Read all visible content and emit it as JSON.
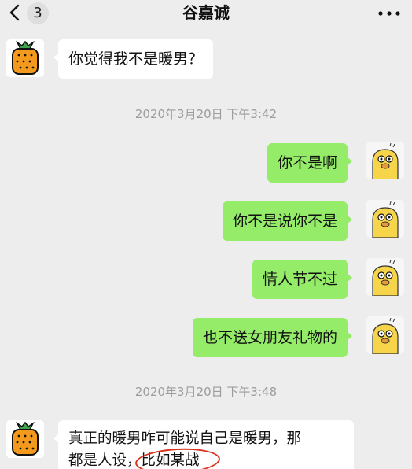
{
  "header": {
    "unread_count": "3",
    "title": "谷嘉诚"
  },
  "timestamps": {
    "t1": "2020年3月20日 下午3:42",
    "t2": "2020年3月20日 下午3:48"
  },
  "messages": {
    "m1": "你觉得我不是暖男？",
    "m2": "你不是啊",
    "m3": "你不是说你不是",
    "m4": "情人节不过",
    "m5": "也不送女朋友礼物的",
    "m6_line1": "真正的暖男咋可能说自己是暖男，那",
    "m6_line2_a": "都是人设，",
    "m6_line2_b": "比如某战"
  },
  "colors": {
    "outgoing_bubble": "#95ec69",
    "incoming_bubble": "#ffffff",
    "background": "#ededed",
    "annotation": "#d9321f"
  },
  "icons": {
    "back": "chevron-left-icon",
    "more": "more-dots-icon",
    "contact_avatar": "orange-avatar",
    "self_avatar": "duck-avatar"
  }
}
